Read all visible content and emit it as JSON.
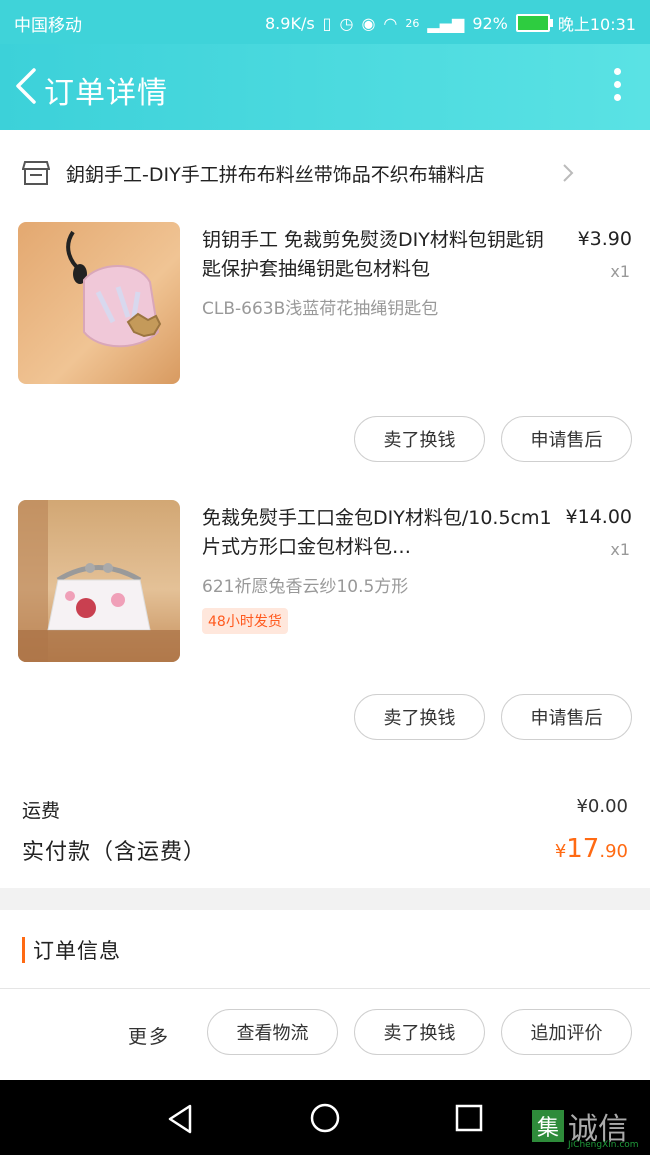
{
  "status_bar": {
    "carrier": "中国移动",
    "speed": "8.9K/s",
    "network": "26",
    "battery": "92%",
    "time": "晚上10:31"
  },
  "header": {
    "title": "订单详情"
  },
  "store": {
    "name": "鈅鈅手工-DIY手工拼布布料丝带饰品不织布辅料店"
  },
  "items": [
    {
      "name": "钥钥手工 免裁剪免熨烫DIY材料包钥匙钥匙保护套抽绳钥匙包材料包",
      "price": "¥3.90",
      "qty": "x1",
      "sku": "CLB-663B浅蓝荷花抽绳钥匙包",
      "tag": "",
      "buttons": [
        "卖了换钱",
        "申请售后"
      ]
    },
    {
      "name": "免裁免熨手工口金包DIY材料包/10.5cm1片式方形口金包材料包…",
      "price": "¥14.00",
      "qty": "x1",
      "sku": "621祈愿兔香云纱10.5方形",
      "tag": "48小时发货",
      "buttons": [
        "卖了换钱",
        "申请售后"
      ]
    }
  ],
  "fees": {
    "shipping_label": "运费",
    "shipping_value": "¥0.00",
    "total_label": "实付款（含运费）",
    "total_currency": "¥",
    "total_int": "17",
    "total_dec": ".90"
  },
  "order_info": {
    "title": "订单信息"
  },
  "actions": {
    "more": "更多",
    "logistics": "查看物流",
    "resell": "卖了换钱",
    "review": "追加评价"
  },
  "watermark": {
    "glyph": "集",
    "text": "诚信",
    "sub": "JiChengXin.com"
  },
  "colors": {
    "header": "#3fd3d9",
    "accent": "#ff6a13"
  }
}
